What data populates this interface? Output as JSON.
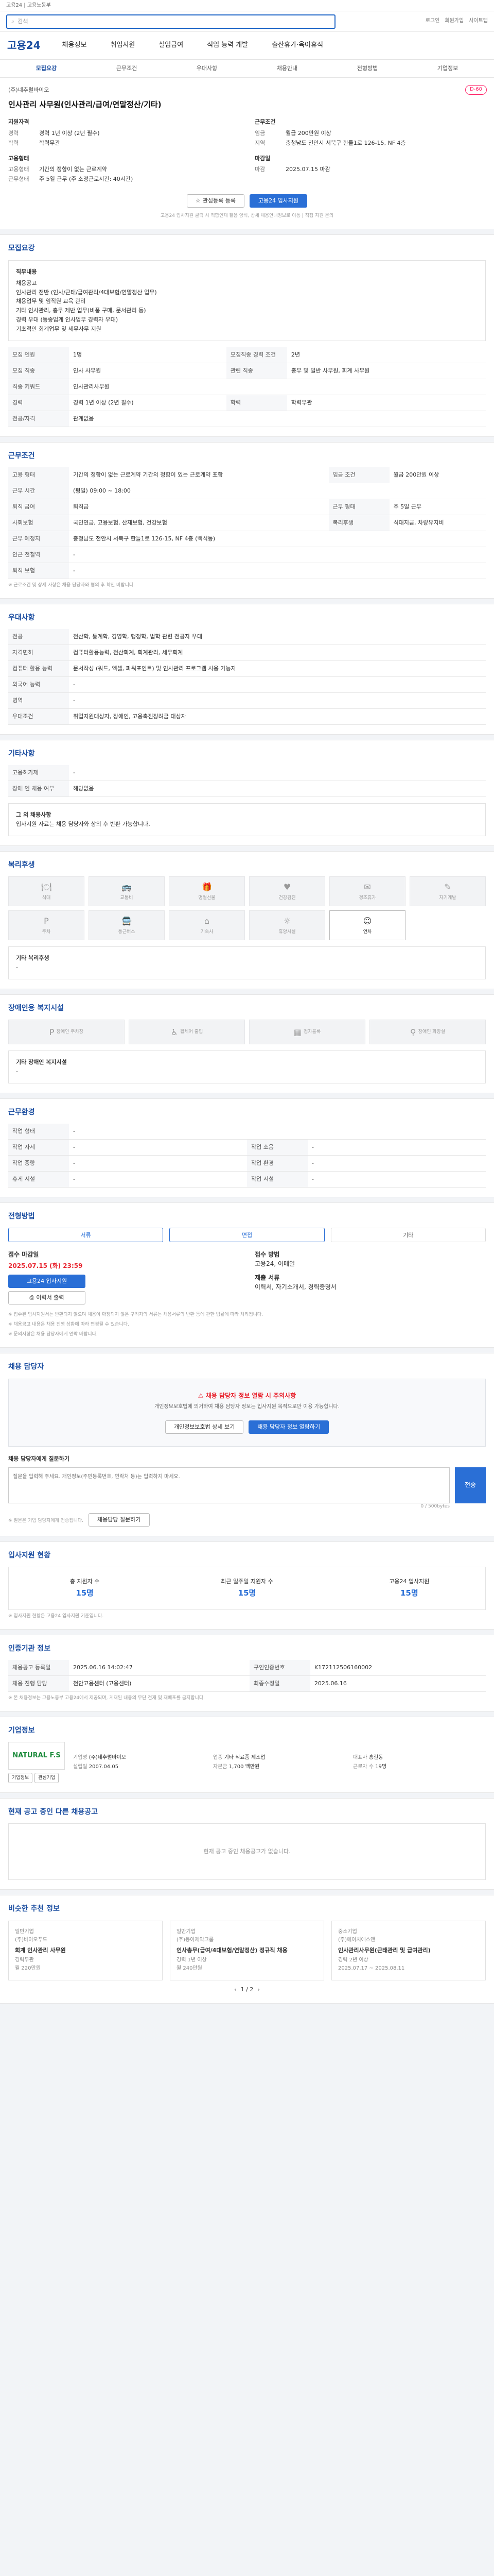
{
  "top": {
    "notice": "고용24 | 고용노동부"
  },
  "search": {
    "placeholder": "검색",
    "links": [
      "로그인",
      "회원가입",
      "사이트맵"
    ]
  },
  "site": {
    "logo": "고용24",
    "nav": [
      "채용정보",
      "취업지원",
      "실업급여",
      "직업 능력 개발",
      "출산휴가·육아휴직"
    ]
  },
  "tabs": [
    "모집요강",
    "근무조건",
    "우대사항",
    "채용안내",
    "전형방법",
    "기업정보"
  ],
  "summary": {
    "company": "(주)네추럴바이오",
    "dday": "D-60",
    "title": "인사관리 사무원(인사관리/급여/연말정산/기타)",
    "left_head": "지원자격",
    "left": [
      [
        "경력",
        "경력 1년 이상 (2년 필수)"
      ],
      [
        "학력",
        "학력무관"
      ]
    ],
    "left2_head": "고용형태",
    "left2": [
      [
        "고용형태",
        "기간의 정함이 없는 근로계약"
      ],
      [
        "근무형태",
        "주 5일 근무 (주 소정근로시간: 40시간)"
      ]
    ],
    "right_head": "근무조건",
    "right": [
      [
        "임금",
        "월급 200만원 이상"
      ],
      [
        "지역",
        "충청남도 천안시 서북구 한들1로 126-15, NF 4층"
      ]
    ],
    "right2_head": "마감일",
    "right2": [
      [
        "마감",
        "2025.07.15 마감"
      ]
    ],
    "btn_scrap": "관심등록 등록",
    "btn_apply": "고용24 입사지원",
    "note": "고용24 입사지원 클릭 시 적합인재 활용 양식, 상세 채용안내정보로 이동 | 직접 지원 문의"
  },
  "recruit": {
    "title": "모집요강",
    "job_head": "직무내용",
    "job_lines": [
      "채용공고",
      "인사관리 전반 (인사/근태/급여관리/4대보험/연말정산 업무)",
      "채용업무 및 임직원 교육 관리",
      "기타 인사관리, 총무 제반 업무(비품 구매, 문서관리 등)",
      "경력 우대 (동종업계 인사업무 경력자 우대)",
      "기초적인 회계업무 및 세무사무 지원"
    ],
    "rows": [
      [
        "모집 인원",
        "1명",
        "모집직종 경력 조건",
        "2년"
      ],
      [
        "모집 직종",
        "인사 사무원",
        "관련 직종",
        "총무 및 일반 사무원, 회계 사무원"
      ],
      [
        "직종 키워드",
        "인사관리사무원",
        "",
        ""
      ],
      [
        "경력",
        "경력 1년 이상 (2년 필수)",
        "학력",
        "학력무관"
      ],
      [
        "전공/자격",
        "관계없음",
        "",
        ""
      ]
    ]
  },
  "work": {
    "title": "근무조건",
    "rows": [
      [
        "고용 형태",
        "기간의 정함이 없는 근로계약  기간의 정함이 있는 근로계약 포함",
        "임금 조건",
        "월급 200만원 이상"
      ],
      [
        "근무 시간",
        "(평일) 09:00 ~ 18:00",
        "",
        ""
      ],
      [
        "퇴직 급여",
        "퇴직금",
        "근무 형태",
        "주 5일 근무"
      ],
      [
        "사회보험",
        "국민연금, 고용보험, 산재보험, 건강보험",
        "복리후생",
        "식대지급, 차량유지비"
      ],
      [
        "근무 예정지",
        "충청남도 천안시 서북구 한들1로 126-15, NF 4층 (백석동)",
        "",
        ""
      ],
      [
        "인근 전철역",
        "-",
        "",
        ""
      ],
      [
        "퇴직 보험",
        "-",
        "",
        ""
      ]
    ],
    "note": "※ 근로조건 및 상세 사항은 채용 담당자와 협의 후 확인 바랍니다."
  },
  "prefer": {
    "title": "우대사항",
    "rows": [
      [
        "전공",
        "전산학, 통계학, 경영학, 행정학, 법학 관련 전공자 우대"
      ],
      [
        "자격면허",
        "컴퓨터활용능력, 전산회계, 회계관리, 세무회계"
      ],
      [
        "컴퓨터 활용 능력",
        "문서작성 (워드, 엑셀, 파워포인트) 및 인사관리 프로그램 사용 가능자"
      ],
      [
        "외국어 능력",
        "-"
      ],
      [
        "병역",
        "-"
      ],
      [
        "우대조건",
        "취업지원대상자, 장애인, 고용촉진장려금 대상자"
      ]
    ]
  },
  "others": {
    "title": "기타사항",
    "rows": [
      [
        "고용허가제",
        "-"
      ],
      [
        "장애 인 채용 여부",
        "해당없음"
      ]
    ]
  },
  "other2": {
    "title": "그 외 채용사항",
    "text": "입사지원 자료는 채용 담당자와 상의 후 반환 가능합니다."
  },
  "welfare": {
    "title": "복리후생",
    "items": [
      [
        "식대",
        "🍽"
      ],
      [
        "교통비",
        "🚌"
      ],
      [
        "명절선물",
        "🎁"
      ],
      [
        "건강검진",
        "♥"
      ],
      [
        "경조휴가",
        "✉"
      ],
      [
        "자기계발",
        "✎"
      ],
      [
        "주차",
        "P"
      ],
      [
        "통근버스",
        "🚍"
      ],
      [
        "기숙사",
        "⌂"
      ],
      [
        "휴양시설",
        "☼"
      ],
      [
        "연차",
        "☺"
      ]
    ],
    "extra": "기타 복리후생",
    "extra_val": "-"
  },
  "disab": {
    "title": "장애인용 복지시설",
    "items": [
      [
        "장애인 주차장",
        "P"
      ],
      [
        "휠체어 출입",
        "♿"
      ],
      [
        "점자블록",
        "▦"
      ],
      [
        "장애인 화장실",
        "⚲"
      ]
    ],
    "extra": "기타 장애인 복지시설",
    "extra_val": "-"
  },
  "env": {
    "title": "근무환경",
    "rows": [
      [
        "작업 형태",
        "-",
        "",
        ""
      ],
      [
        "작업 자세",
        "-",
        "작업 소음",
        "-"
      ],
      [
        "작업 중량",
        "-",
        "작업 환경",
        "-"
      ],
      [
        "휴게 시설",
        "-",
        "작업 시설",
        "-"
      ]
    ]
  },
  "process": {
    "title": "전형방법",
    "steps": [
      "서류",
      "면접",
      "기타"
    ],
    "deadline_head": "접수 마감일",
    "deadline": "2025.07.15 (화) 23:59",
    "submit_head": "접수 방법",
    "submit": "고용24, 이메일",
    "docs_head": "제출 서류",
    "docs": "이력서, 자기소개서, 경력증명서",
    "btn_apply": "고용24 입사지원",
    "btn_print": "이력서 출력",
    "notes": [
      "※ 접수된 입사지원서는 반환되지 않으며 채용이 확정되지 않은 구직자의 서류는 채용서류의 반환 등에 관한 법률에 따라 처리됩니다.",
      "※ 채용공고 내용은 채용 진행 상황에 따라 변경될 수 있습니다.",
      "※ 문의사항은 채용 담당자에게 연락 바랍니다."
    ]
  },
  "manager": {
    "title": "채용 담당자",
    "warn": "채용 담당자 정보 열람 시 주의사항",
    "desc": "개인정보보호법에 의거하여 채용 담당자 정보는 입사지원 목적으로만 이용 가능합니다.",
    "btn1": "개인정보보호법 상세 보기",
    "btn2": "채용 담당자 정보 열람하기"
  },
  "inquiry": {
    "title": "채용 담당자에게 질문하기",
    "placeholder": "질문을 입력해 주세요. 개인정보(주민등록번호, 연락처 등)는 입력하지 마세요.",
    "count": "0 / 500bytes",
    "send": "전송",
    "note": "※ 질문은 기업 담당자에게 전송됩니다.",
    "btn": "채용담당 질문하기"
  },
  "stats": {
    "title": "입사지원 현황",
    "items": [
      [
        "총 지원자 수",
        "15명"
      ],
      [
        "최근 일주일 지원자 수",
        "15명"
      ],
      [
        "고용24 입사지원",
        "15명"
      ]
    ],
    "note": "※ 입사지원 현황은 고용24 입사지원 기준입니다."
  },
  "info": {
    "title": "인증기관 정보",
    "rows": [
      [
        "채용공고 등록일",
        "2025.06.16 14:02:47",
        "구인인증번호",
        "K172112506160002"
      ],
      [
        "채용 진행 담당",
        "천안고용센터 (고용센터)",
        "최종수정일",
        "2025.06.16"
      ]
    ],
    "note": "※ 본 채용정보는 고용노동부 고용24에서 제공되며, 게재된 내용의 무단 전재 및 재배포를 금지합니다."
  },
  "company": {
    "title": "기업정보",
    "logo": "NATURAL F.S",
    "rows": [
      [
        "기업명",
        "(주)네추럴바이오"
      ],
      [
        "업종",
        "기타 식료품 제조업"
      ],
      [
        "대표자",
        "홍길동"
      ],
      [
        "설립일",
        "2007.04.05"
      ],
      [
        "자본금",
        "1,700 백만원"
      ],
      [
        "근로자 수",
        "19명"
      ]
    ],
    "btns": [
      "기업정보",
      "관심기업"
    ]
  },
  "similar": {
    "title": "현재 공고 중인 다른 채용공고",
    "empty": "현재 공고 중인 채용공고가 없습니다."
  },
  "recommend": {
    "title": "비슷한 추천 정보",
    "pager": "1 / 2",
    "cards": [
      {
        "tag": "일반기업",
        "company": "(주)바이오푸드",
        "title": "회계 인사관리 사무원",
        "m1": "경력무관",
        "m2": "월 220만원"
      },
      {
        "tag": "일반기업",
        "company": "(주)동아제약그룹",
        "title": "인사총무(급여/4대보험/연말정산) 정규직 채용",
        "m1": "경력 1년 이상",
        "m2": "월 240만원"
      },
      {
        "tag": "중소기업",
        "company": "(주)에이치에스앤",
        "title": "인사관리사무원(근태관리 및 급여관리)",
        "m1": "경력 2년 이상",
        "m2": "2025.07.17 ~ 2025.08.11"
      }
    ]
  }
}
